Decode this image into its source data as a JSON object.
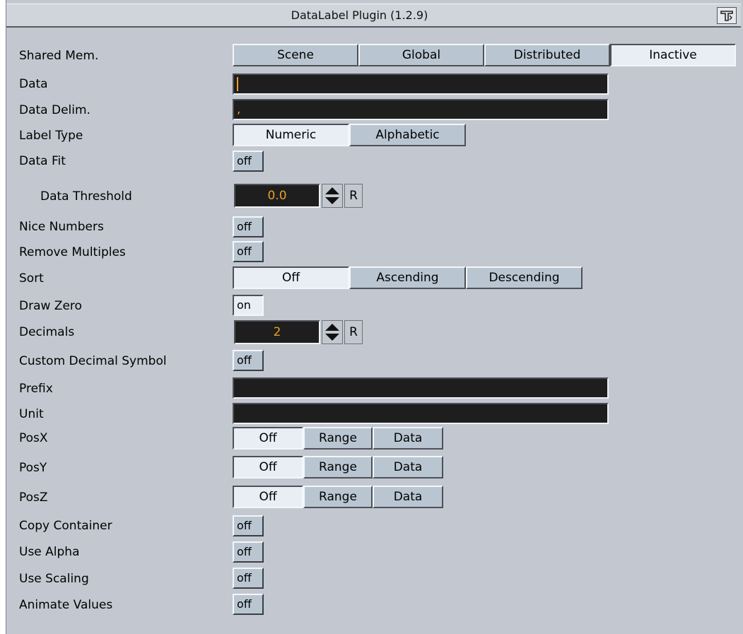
{
  "window": {
    "title": "DataLabel Plugin (1.2.9)",
    "help_icon": "help-icon"
  },
  "shared_mem": {
    "label": "Shared Mem.",
    "options": [
      "Scene",
      "Global",
      "Distributed",
      "Inactive"
    ],
    "selected": "Inactive"
  },
  "data": {
    "label": "Data",
    "value": ""
  },
  "data_delim": {
    "label": "Data Delim.",
    "value": ","
  },
  "label_type": {
    "label": "Label Type",
    "options": [
      "Numeric",
      "Alphabetic"
    ],
    "selected": "Numeric"
  },
  "data_fit": {
    "label": "Data Fit",
    "value": "off"
  },
  "data_threshold": {
    "label": "Data Threshold",
    "value": "0.0",
    "reset": "R"
  },
  "nice_numbers": {
    "label": "Nice Numbers",
    "value": "off"
  },
  "remove_multiples": {
    "label": "Remove Multiples",
    "value": "off"
  },
  "sort": {
    "label": "Sort",
    "options": [
      "Off",
      "Ascending",
      "Descending"
    ],
    "selected": "Off"
  },
  "draw_zero": {
    "label": "Draw Zero",
    "value": "on"
  },
  "decimals": {
    "label": "Decimals",
    "value": "2",
    "reset": "R"
  },
  "custom_decimal_symbol": {
    "label": "Custom Decimal Symbol",
    "value": "off"
  },
  "prefix": {
    "label": "Prefix",
    "value": ""
  },
  "unit": {
    "label": "Unit",
    "value": ""
  },
  "posx": {
    "label": "PosX",
    "options": [
      "Off",
      "Range",
      "Data"
    ],
    "selected": "Off"
  },
  "posy": {
    "label": "PosY",
    "options": [
      "Off",
      "Range",
      "Data"
    ],
    "selected": "Off"
  },
  "posz": {
    "label": "PosZ",
    "options": [
      "Off",
      "Range",
      "Data"
    ],
    "selected": "Off"
  },
  "copy_container": {
    "label": "Copy Container",
    "value": "off"
  },
  "use_alpha": {
    "label": "Use Alpha",
    "value": "off"
  },
  "use_scaling": {
    "label": "Use Scaling",
    "value": "off"
  },
  "animate_values": {
    "label": "Animate Values",
    "value": "off"
  }
}
